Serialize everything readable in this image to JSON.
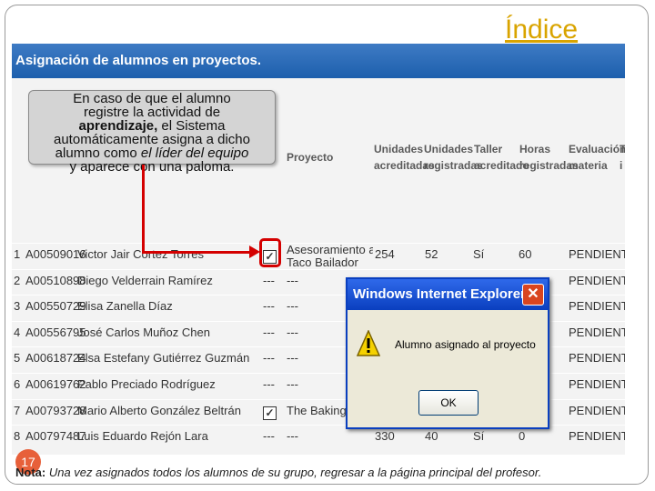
{
  "index_link": "Índice",
  "app": {
    "title": "Asignación de alumnos en proyectos.",
    "headers": {
      "proyecto": "Proyecto",
      "unidades_acreditadas": [
        "Unidades",
        "acreditadas"
      ],
      "unidades_registradas": [
        "Unidades",
        "registradas"
      ],
      "taller_acreditado": [
        "Taller",
        "acreditado"
      ],
      "horas_registradas": [
        "Horas",
        "registradas"
      ],
      "evaluacion_materia": [
        "Evaluación",
        "materia"
      ],
      "overflow": [
        "T",
        "i"
      ]
    },
    "rows": [
      {
        "num": "1",
        "id": "A00509016",
        "name": "Victor Jair Cortez Torres",
        "assigned": "checked",
        "project": [
          "Asesoramiento al",
          "Taco Bailador"
        ],
        "ua": "254",
        "ur": "52",
        "ta": "Sí",
        "hr": "60",
        "ev": "PENDIENTE"
      },
      {
        "num": "2",
        "id": "A00510898",
        "name": "Diego Velderrain Ramírez",
        "assigned": "---",
        "project": [
          "---"
        ],
        "ua": "",
        "ur": "",
        "ta": "",
        "hr": "",
        "ev": "PENDIENTE"
      },
      {
        "num": "3",
        "id": "A00550729",
        "name": "Elisa Zanella Díaz",
        "assigned": "---",
        "project": [
          "---"
        ],
        "ua": "",
        "ur": "",
        "ta": "",
        "hr": "",
        "ev": "PENDIENTE"
      },
      {
        "num": "4",
        "id": "A00556795",
        "name": "José Carlos Muñoz Chen",
        "assigned": "---",
        "project": [
          "---"
        ],
        "ua": "",
        "ur": "",
        "ta": "",
        "hr": "",
        "ev": "PENDIENTE"
      },
      {
        "num": "5",
        "id": "A00618724",
        "name": "Elsa Estefany Gutiérrez Guzmán",
        "assigned": "---",
        "project": [
          "---"
        ],
        "ua": "",
        "ur": "",
        "ta": "",
        "hr": "",
        "ev": "PENDIENTE"
      },
      {
        "num": "6",
        "id": "A00619762",
        "name": "Pablo Preciado Rodríguez",
        "assigned": "---",
        "project": [
          "---"
        ],
        "ua": "",
        "ur": "",
        "ta": "",
        "hr": "",
        "ev": "PENDIENTE"
      },
      {
        "num": "7",
        "id": "A00793728",
        "name": "Mario Alberto González Beltrán",
        "assigned": "checked",
        "project": [
          "The Baking Sh"
        ],
        "ua": "",
        "ur": "",
        "ta": "",
        "hr": "",
        "ev": "PENDIENTE"
      },
      {
        "num": "8",
        "id": "A00797487",
        "name": "Luis Eduardo Rejón Lara",
        "assigned": "---",
        "project": [
          "---"
        ],
        "ua": "330",
        "ur": "40",
        "ta": "Sí",
        "hr": "0",
        "ev": "PENDIENTE"
      }
    ]
  },
  "callout": {
    "line1": "En caso de que el alumno",
    "line2": "registre la actividad de",
    "line3_bold": "aprendizaje,",
    "line3_rest": " el Sistema",
    "line4": "automáticamente asigna a dicho",
    "line5_a": "alumno como ",
    "line5_italic": "el líder del equipo",
    "line6": "y aparece con una paloma."
  },
  "dialog": {
    "title": "Windows Internet Explorer",
    "message": "Alumno asignado al proyecto",
    "ok": "OK",
    "close": "✕"
  },
  "slide_number": "17",
  "note": {
    "label": "Nota:",
    "text": " Una vez asignados todos los alumnos de su grupo, regresar a la página principal del profesor."
  },
  "colors": {
    "accent_red": "#d40000",
    "title_blue": "#1d5fad",
    "index_gold": "#d9a400",
    "badge": "#e7603a"
  }
}
